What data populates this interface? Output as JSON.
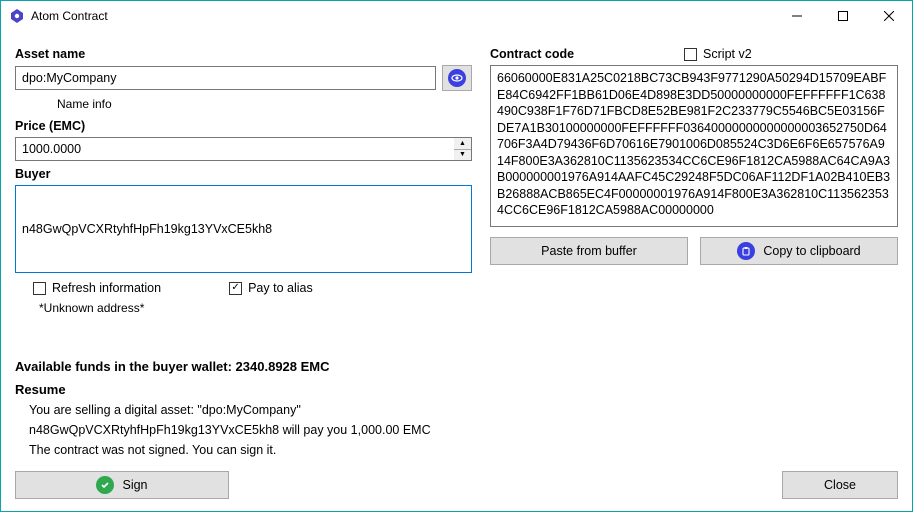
{
  "window": {
    "title": "Atom Contract"
  },
  "left": {
    "asset_name_label": "Asset name",
    "asset_name_value": "dpo:MyCompany",
    "name_info": "Name info",
    "price_label": "Price (EMC)",
    "price_value": "1000.0000",
    "buyer_label": "Buyer",
    "buyer_value": "n48GwQpVCXRtyhfHpFh19kg13YVxCE5kh8",
    "refresh_label": "Refresh information",
    "refresh_checked": false,
    "pay_alias_label": "Pay to alias",
    "pay_alias_checked": true,
    "unknown_addr": "*Unknown address*",
    "available_funds": "Available funds in the buyer wallet: 2340.8928 EMC",
    "resume_heading": "Resume",
    "resume_line1": "You are selling a digital asset: \"dpo:MyCompany\"",
    "resume_line2": "n48GwQpVCXRtyhfHpFh19kg13YVxCE5kh8 will pay you 1,000.00 EMC",
    "resume_line3": "The contract was not signed. You can sign it.",
    "sign_label": "Sign",
    "close_label": "Close"
  },
  "right": {
    "code_label": "Contract code",
    "script_v2_label": "Script v2",
    "script_v2_checked": false,
    "code_value": "66060000E831A25C0218BC73CB943F9771290A50294D15709EABFE84C6942FF1BB61D06E4D898E3DD50000000000FEFFFFFF1C638490C938F1F76D71FBCD8E52BE981F2C233779C5546BC5E03156FDE7A1B30100000000FEFFFFFF03640000000000000003652750D64706F3A4D79436F6D70616E7901006D085524C3D6E6F6E657576A914F800E3A362810C1135623534CC6CE96F1812CA5988AC64CA9A3B000000001976A914AAFC45C29248F5DC06AF112DF1A02B410EB3B26888ACB865EC4F00000001976A914F800E3A362810C1135623534CC6CE96F1812CA5988AC00000000",
    "paste_label": "Paste from buffer",
    "copy_label": "Copy to clipboard"
  }
}
